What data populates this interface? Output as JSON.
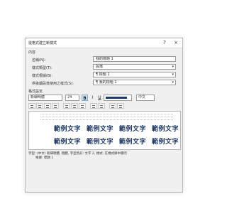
{
  "dialog": {
    "title": "從格式建立新樣式",
    "help_icon": "?",
    "close_icon": "×"
  },
  "properties": {
    "section": "內容",
    "name_label": "名稱(N):",
    "name_value": "我的標題 1",
    "type_label": "樣式類型(T):",
    "type_value": "段落",
    "based_on_label": "樣式根據(B):",
    "based_on_value": "¶ 標題 1",
    "next_label": "供後續段落使用之樣式(S):",
    "next_value": "¶ 我的標題 1"
  },
  "formatting": {
    "section": "格式設定",
    "font": "新細明體",
    "size": "24",
    "bold": "B",
    "italic": "I",
    "underline": "U",
    "font_color": "#1f3864",
    "language": "中文"
  },
  "preview": {
    "sample_words": [
      "範例文字",
      "範例文字",
      "範例文字",
      "範例文字"
    ]
  },
  "description": {
    "line1": "字型: (中文) 新細明體, 粗體, 字型色彩: 文字 2, 樣式: 在樣式庫中顯示",
    "line2": "根據: 標題 1"
  }
}
